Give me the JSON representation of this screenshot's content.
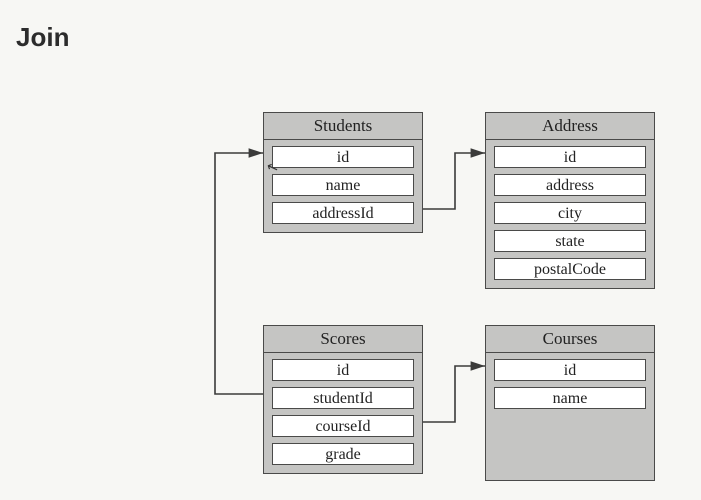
{
  "title": "Join",
  "tables": {
    "students": {
      "name": "Students",
      "fields": [
        "id",
        "name",
        "addressId"
      ]
    },
    "address": {
      "name": "Address",
      "fields": [
        "id",
        "address",
        "city",
        "state",
        "postalCode"
      ]
    },
    "scores": {
      "name": "Scores",
      "fields": [
        "id",
        "studentId",
        "courseId",
        "grade"
      ]
    },
    "courses": {
      "name": "Courses",
      "fields": [
        "id",
        "name"
      ]
    }
  },
  "relations": [
    {
      "from": "students.addressId",
      "to": "address.id"
    },
    {
      "from": "scores.studentId",
      "to": "students.id"
    },
    {
      "from": "scores.courseId",
      "to": "courses.id"
    }
  ]
}
